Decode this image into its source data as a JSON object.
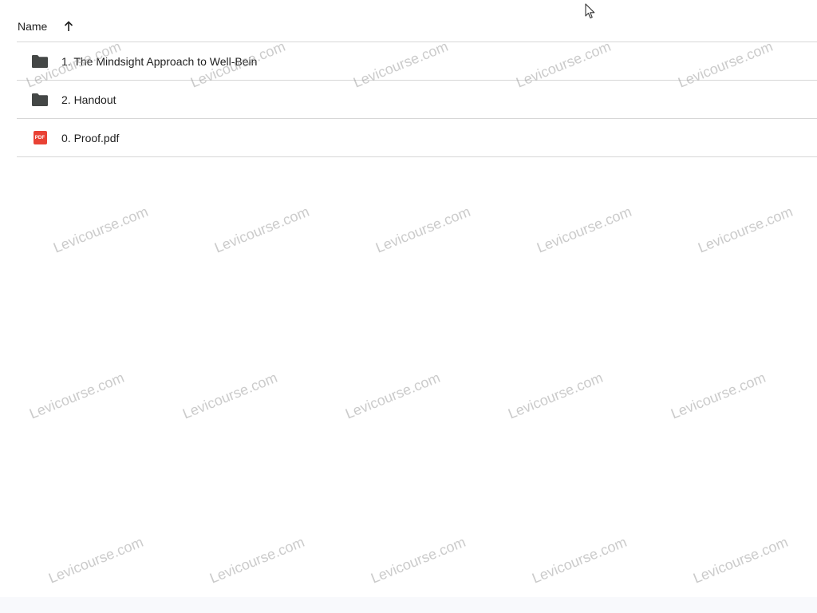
{
  "header": {
    "name_label": "Name",
    "sort_icon": "arrow-up-icon"
  },
  "files": [
    {
      "name": "1. The Mindsight Approach to Well-Bein",
      "icon": "folder-icon"
    },
    {
      "name": "2. Handout",
      "icon": "folder-icon"
    },
    {
      "name": "0. Proof.pdf",
      "icon": "pdf-icon",
      "badge": "PDF"
    }
  ],
  "watermark": "Levicourse.com",
  "colors": {
    "pdf_red": "#e94235",
    "folder_gray": "#444746",
    "divider": "#d7d7d7"
  }
}
